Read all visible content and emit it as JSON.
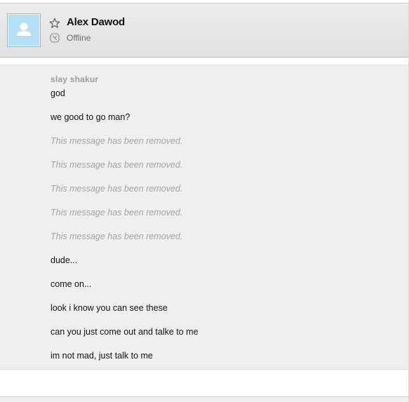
{
  "contact": {
    "name": "Alex Dawod",
    "status": "Offline"
  },
  "icons": {
    "avatar": "default-avatar-icon",
    "favorite": "star-outline-icon",
    "status": "offline-status-icon"
  },
  "colors": {
    "avatar_bg": "#b5dff4",
    "removed_text": "#a3a3a3",
    "sender_name": "#9b9b9b"
  },
  "conversation": {
    "sender": "slay shakur",
    "messages": [
      {
        "text": "god",
        "removed": false
      },
      {
        "text": "we good to go man?",
        "removed": false
      },
      {
        "text": "This message has been removed.",
        "removed": true
      },
      {
        "text": "This message has been removed.",
        "removed": true
      },
      {
        "text": "This message has been removed.",
        "removed": true
      },
      {
        "text": "This message has been removed.",
        "removed": true
      },
      {
        "text": "This message has been removed.",
        "removed": true
      },
      {
        "text": "dude...",
        "removed": false
      },
      {
        "text": "come on...",
        "removed": false
      },
      {
        "text": "look i know you can see these",
        "removed": false
      },
      {
        "text": "can you just come out and talke to me",
        "removed": false
      },
      {
        "text": "im not mad, just talk to me",
        "removed": false
      }
    ]
  }
}
